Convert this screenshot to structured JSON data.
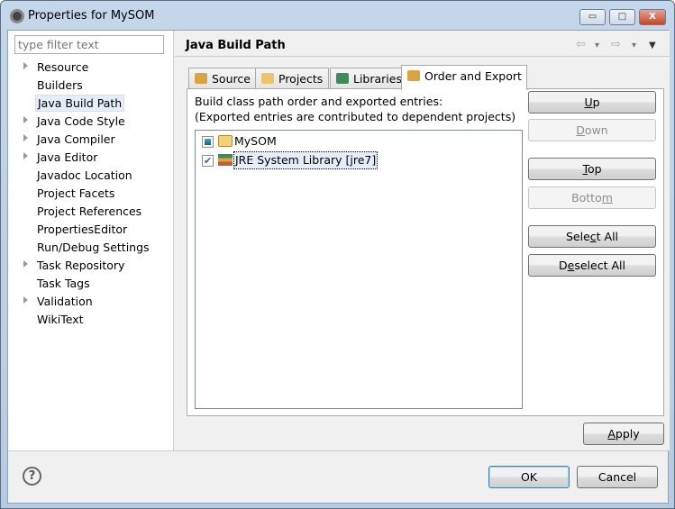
{
  "window": {
    "title": "Properties for MySOM",
    "minimize": "▭",
    "maximize": "□",
    "close": "X"
  },
  "filter": {
    "placeholder": "type filter text"
  },
  "tree": [
    {
      "label": "Resource",
      "expandable": true
    },
    {
      "label": "Builders",
      "expandable": false
    },
    {
      "label": "Java Build Path",
      "expandable": false,
      "selected": true
    },
    {
      "label": "Java Code Style",
      "expandable": true
    },
    {
      "label": "Java Compiler",
      "expandable": true
    },
    {
      "label": "Java Editor",
      "expandable": true
    },
    {
      "label": "Javadoc Location",
      "expandable": false
    },
    {
      "label": "Project Facets",
      "expandable": false
    },
    {
      "label": "Project References",
      "expandable": false
    },
    {
      "label": "PropertiesEditor",
      "expandable": false
    },
    {
      "label": "Run/Debug Settings",
      "expandable": false
    },
    {
      "label": "Task Repository",
      "expandable": true
    },
    {
      "label": "Task Tags",
      "expandable": false
    },
    {
      "label": "Validation",
      "expandable": true
    },
    {
      "label": "WikiText",
      "expandable": false
    }
  ],
  "page": {
    "title": "Java Build Path",
    "nav": {
      "back": "⇦",
      "forward": "⇨",
      "dropdown": "▾",
      "menu": "▼"
    },
    "tabs": [
      {
        "label": "Source",
        "icon": "source-folder-icon"
      },
      {
        "label": "Projects",
        "icon": "project-folder-icon"
      },
      {
        "label": "Libraries",
        "icon": "library-icon"
      },
      {
        "label": "Order and Export",
        "icon": "order-arrows-icon",
        "active": true
      }
    ],
    "desc1": "Build class path order and exported entries:",
    "desc2": "(Exported entries are contributed to dependent projects)",
    "entries": [
      {
        "label": "MySOM",
        "state": "partial",
        "icon": "project-folder-icon"
      },
      {
        "label": "JRE System Library [jre7]",
        "state": "checked",
        "icon": "library-icon",
        "focused": true
      }
    ],
    "buttons": [
      {
        "pre": "",
        "key": "U",
        "post": "p",
        "enabled": true
      },
      {
        "pre": "",
        "key": "D",
        "post": "own",
        "enabled": false
      },
      {
        "pre": "",
        "key": "T",
        "post": "op",
        "enabled": true
      },
      {
        "pre": "Botto",
        "key": "m",
        "post": "",
        "enabled": false
      },
      {
        "pre": "Sele",
        "key": "c",
        "post": "t All",
        "enabled": true
      },
      {
        "pre": "D",
        "key": "e",
        "post": "select All",
        "enabled": true
      }
    ],
    "apply": {
      "pre": "",
      "key": "A",
      "post": "pply"
    }
  },
  "footer": {
    "help": "?",
    "ok": "OK",
    "cancel": "Cancel"
  }
}
